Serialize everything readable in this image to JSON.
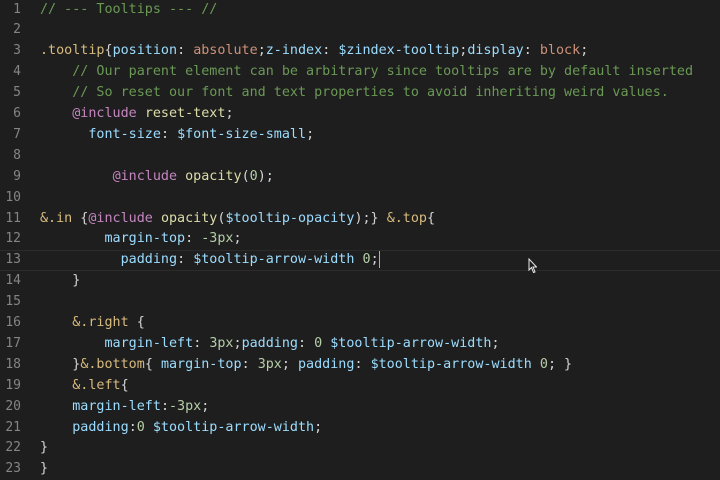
{
  "editor": {
    "current_line": 13,
    "lines": [
      {
        "n": "1",
        "tokens": [
          {
            "t": "// --- Tooltips --- //",
            "c": "comment"
          }
        ]
      },
      {
        "n": "2",
        "tokens": []
      },
      {
        "n": "3",
        "tokens": [
          {
            "t": ".tooltip",
            "c": "sel"
          },
          {
            "t": "{",
            "c": "punc"
          },
          {
            "t": "position",
            "c": "prop"
          },
          {
            "t": ": ",
            "c": "punc"
          },
          {
            "t": "absolute",
            "c": "val"
          },
          {
            "t": ";",
            "c": "punc"
          },
          {
            "t": "z-index",
            "c": "prop"
          },
          {
            "t": ": ",
            "c": "punc"
          },
          {
            "t": "$zindex-tooltip",
            "c": "var"
          },
          {
            "t": ";",
            "c": "punc"
          },
          {
            "t": "display",
            "c": "prop"
          },
          {
            "t": ": ",
            "c": "punc"
          },
          {
            "t": "block",
            "c": "val"
          },
          {
            "t": ";",
            "c": "punc"
          }
        ]
      },
      {
        "n": "4",
        "tokens": [
          {
            "t": "    // Our parent element can be arbitrary since tooltips are by default inserted",
            "c": "comment"
          }
        ]
      },
      {
        "n": "5",
        "tokens": [
          {
            "t": "    // So reset our font and text properties to avoid inheriting weird values.",
            "c": "comment"
          }
        ]
      },
      {
        "n": "6",
        "tokens": [
          {
            "t": "    ",
            "c": "punc"
          },
          {
            "t": "@include",
            "c": "at"
          },
          {
            "t": " ",
            "c": "punc"
          },
          {
            "t": "reset-text",
            "c": "fn"
          },
          {
            "t": ";",
            "c": "punc"
          }
        ]
      },
      {
        "n": "7",
        "tokens": [
          {
            "t": "      ",
            "c": "punc"
          },
          {
            "t": "font-size",
            "c": "prop"
          },
          {
            "t": ": ",
            "c": "punc"
          },
          {
            "t": "$font-size-small",
            "c": "var"
          },
          {
            "t": ";",
            "c": "punc"
          }
        ]
      },
      {
        "n": "8",
        "tokens": []
      },
      {
        "n": "9",
        "tokens": [
          {
            "t": "         ",
            "c": "punc"
          },
          {
            "t": "@include",
            "c": "at"
          },
          {
            "t": " ",
            "c": "punc"
          },
          {
            "t": "opacity",
            "c": "fn"
          },
          {
            "t": "(",
            "c": "punc"
          },
          {
            "t": "0",
            "c": "num"
          },
          {
            "t": ");",
            "c": "punc"
          }
        ]
      },
      {
        "n": "10",
        "tokens": []
      },
      {
        "n": "11",
        "tokens": [
          {
            "t": "&.in",
            "c": "sel"
          },
          {
            "t": " {",
            "c": "punc"
          },
          {
            "t": "@include",
            "c": "at"
          },
          {
            "t": " ",
            "c": "punc"
          },
          {
            "t": "opacity",
            "c": "fn"
          },
          {
            "t": "(",
            "c": "punc"
          },
          {
            "t": "$tooltip-opacity",
            "c": "var"
          },
          {
            "t": ");} ",
            "c": "punc"
          },
          {
            "t": "&.top",
            "c": "sel"
          },
          {
            "t": "{",
            "c": "punc"
          }
        ]
      },
      {
        "n": "12",
        "tokens": [
          {
            "t": "        ",
            "c": "punc"
          },
          {
            "t": "margin-top",
            "c": "prop"
          },
          {
            "t": ": ",
            "c": "punc"
          },
          {
            "t": "-3px",
            "c": "num"
          },
          {
            "t": ";",
            "c": "punc"
          }
        ]
      },
      {
        "n": "13",
        "tokens": [
          {
            "t": "          ",
            "c": "punc"
          },
          {
            "t": "padding",
            "c": "prop"
          },
          {
            "t": ": ",
            "c": "punc"
          },
          {
            "t": "$tooltip-arrow-width",
            "c": "var"
          },
          {
            "t": " ",
            "c": "punc"
          },
          {
            "t": "0",
            "c": "num"
          },
          {
            "t": ";",
            "c": "punc"
          }
        ]
      },
      {
        "n": "14",
        "tokens": [
          {
            "t": "    }",
            "c": "punc"
          }
        ]
      },
      {
        "n": "15",
        "tokens": []
      },
      {
        "n": "16",
        "tokens": [
          {
            "t": "    ",
            "c": "punc"
          },
          {
            "t": "&.right",
            "c": "sel"
          },
          {
            "t": " {",
            "c": "punc"
          }
        ]
      },
      {
        "n": "17",
        "tokens": [
          {
            "t": "        ",
            "c": "punc"
          },
          {
            "t": "margin-left",
            "c": "prop"
          },
          {
            "t": ": ",
            "c": "punc"
          },
          {
            "t": "3px",
            "c": "num"
          },
          {
            "t": ";",
            "c": "punc"
          },
          {
            "t": "padding",
            "c": "prop"
          },
          {
            "t": ": ",
            "c": "punc"
          },
          {
            "t": "0",
            "c": "num"
          },
          {
            "t": " ",
            "c": "punc"
          },
          {
            "t": "$tooltip-arrow-width",
            "c": "var"
          },
          {
            "t": ";",
            "c": "punc"
          }
        ]
      },
      {
        "n": "18",
        "tokens": [
          {
            "t": "    }",
            "c": "punc"
          },
          {
            "t": "&.bottom",
            "c": "sel"
          },
          {
            "t": "{ ",
            "c": "punc"
          },
          {
            "t": "margin-top",
            "c": "prop"
          },
          {
            "t": ": ",
            "c": "punc"
          },
          {
            "t": "3px",
            "c": "num"
          },
          {
            "t": "; ",
            "c": "punc"
          },
          {
            "t": "padding",
            "c": "prop"
          },
          {
            "t": ": ",
            "c": "punc"
          },
          {
            "t": "$tooltip-arrow-width",
            "c": "var"
          },
          {
            "t": " ",
            "c": "punc"
          },
          {
            "t": "0",
            "c": "num"
          },
          {
            "t": "; }",
            "c": "punc"
          }
        ]
      },
      {
        "n": "19",
        "tokens": [
          {
            "t": "    ",
            "c": "punc"
          },
          {
            "t": "&.left",
            "c": "sel"
          },
          {
            "t": "{",
            "c": "punc"
          }
        ]
      },
      {
        "n": "20",
        "tokens": [
          {
            "t": "    ",
            "c": "punc"
          },
          {
            "t": "margin-left",
            "c": "prop"
          },
          {
            "t": ":",
            "c": "punc"
          },
          {
            "t": "-3px",
            "c": "num"
          },
          {
            "t": ";",
            "c": "punc"
          }
        ]
      },
      {
        "n": "21",
        "tokens": [
          {
            "t": "    ",
            "c": "punc"
          },
          {
            "t": "padding",
            "c": "prop"
          },
          {
            "t": ":",
            "c": "punc"
          },
          {
            "t": "0",
            "c": "num"
          },
          {
            "t": " ",
            "c": "punc"
          },
          {
            "t": "$tooltip-arrow-width",
            "c": "var"
          },
          {
            "t": ";",
            "c": "punc"
          }
        ]
      },
      {
        "n": "22",
        "tokens": [
          {
            "t": "}",
            "c": "punc"
          }
        ]
      },
      {
        "n": "23",
        "tokens": [
          {
            "t": "}",
            "c": "punc"
          }
        ]
      }
    ]
  },
  "colors": {
    "background": "#1e1e1e",
    "gutter": "#858585",
    "comment": "#6a9955",
    "selector": "#d7ba7d",
    "property": "#9cdcfe",
    "value": "#ce9178",
    "number": "#b5cea8",
    "at_rule": "#c586c0",
    "function": "#dcdcaa"
  },
  "icons": {
    "mouse": "i-beam-cursor-icon",
    "caret": "text-caret-icon"
  }
}
